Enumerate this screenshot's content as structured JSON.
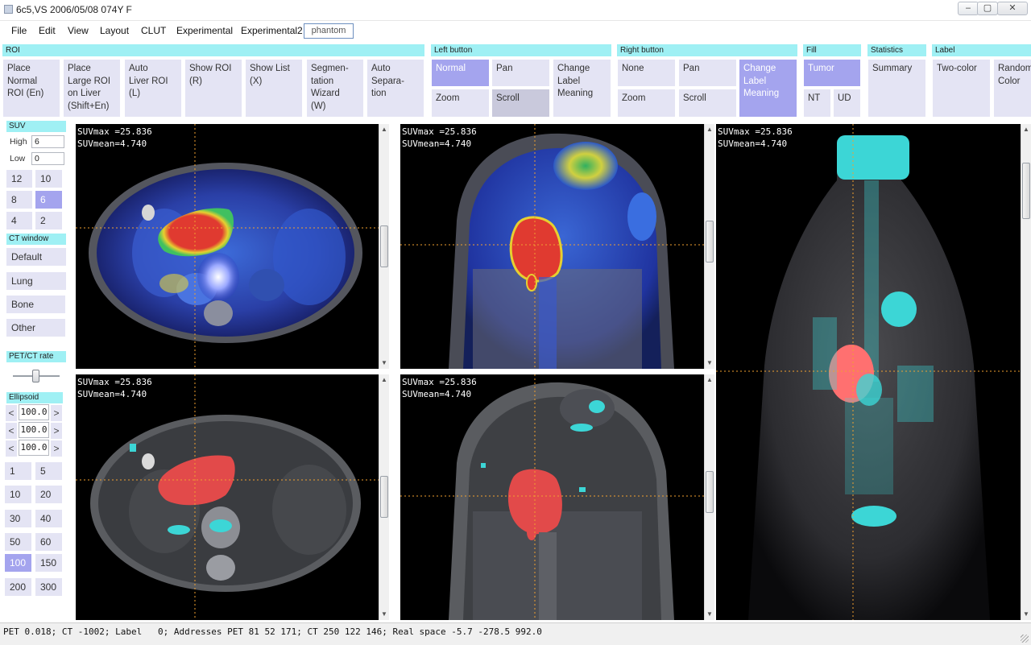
{
  "window": {
    "title": "6c5,VS 2006/05/08 074Y F",
    "minimize_glyph": "‒",
    "maximize_glyph": "▢",
    "close_glyph": "✕"
  },
  "menu": {
    "file": "File",
    "edit": "Edit",
    "view": "View",
    "layout": "Layout",
    "clut": "CLUT",
    "experimental": "Experimental",
    "experimental2": "Experimental2",
    "phantom": "phantom"
  },
  "toolbar": {
    "roi": {
      "header": "ROI",
      "place_normal": "Place\nNormal\nROI (En)",
      "place_large": "Place\nLarge ROI\non Liver\n(Shift+En)",
      "auto_liver": "Auto\nLiver ROI\n(L)",
      "show_roi": "Show ROI\n(R)",
      "show_list": "Show List\n(X)",
      "segmentation": "Segmen-\ntation\nWizard\n(W)",
      "auto_separation": "Auto\nSepara-\ntion"
    },
    "left_button": {
      "header": "Left button",
      "normal": "Normal",
      "pan": "Pan",
      "change_label": "Change\nLabel\nMeaning",
      "zoom": "Zoom",
      "scroll": "Scroll"
    },
    "right_button": {
      "header": "Right button",
      "none": "None",
      "pan": "Pan",
      "change_label": "Change\nLabel\nMeaning",
      "zoom": "Zoom",
      "scroll": "Scroll"
    },
    "fill": {
      "header": "Fill",
      "tumor": "Tumor",
      "nt": "NT",
      "ud": "UD"
    },
    "statistics": {
      "header": "Statistics",
      "summary": "Summary"
    },
    "label": {
      "header": "Label",
      "two_color": "Two-color",
      "random_color": "Random\nColor"
    }
  },
  "left_panel": {
    "suv": {
      "header": "SUV",
      "high_label": "High",
      "high_value": "6",
      "low_label": "Low",
      "low_value": "0",
      "presets": [
        "12",
        "10",
        "8",
        "6",
        "4",
        "2"
      ],
      "selected": "6"
    },
    "ct_window": {
      "header": "CT window",
      "options": [
        "Default",
        "Lung",
        "Bone",
        "Other"
      ]
    },
    "petct": {
      "header": "PET/CT rate",
      "rate": 0.5
    },
    "ellipsoid": {
      "header": "Ellipsoid",
      "values": [
        "100.0",
        "100.0",
        "100.0"
      ],
      "left_arrow": "<",
      "right_arrow": ">",
      "presets": [
        "1",
        "5",
        "10",
        "20",
        "30",
        "40",
        "50",
        "60",
        "100",
        "150",
        "200",
        "300"
      ],
      "selected": "100"
    }
  },
  "viewports": {
    "axial_fused": "SUVmax =25.836\nSUVmean=4.740",
    "coronal_fused": "SUVmax =25.836\nSUVmean=4.740",
    "mip": "SUVmax =25.836\nSUVmean=4.740",
    "axial_ct": "SUVmax =25.836\nSUVmean=4.740",
    "coronal_ct": "SUVmax =25.836\nSUVmean=4.740"
  },
  "scroll_arrows": {
    "up": "▲",
    "down": "▼"
  },
  "status": "PET 0.018; CT -1002; Label   0; Addresses PET 81 52 171; CT 250 122 146; Real space -5.7 -278.5 992.0",
  "colors": {
    "group_header": "#9ff0f4",
    "button": "#e4e4f4",
    "button_active": "#a4a4ee",
    "tumor": "#e24a4a",
    "label_cyan": "#3cd6d6",
    "crosshair": "#f0a030"
  }
}
